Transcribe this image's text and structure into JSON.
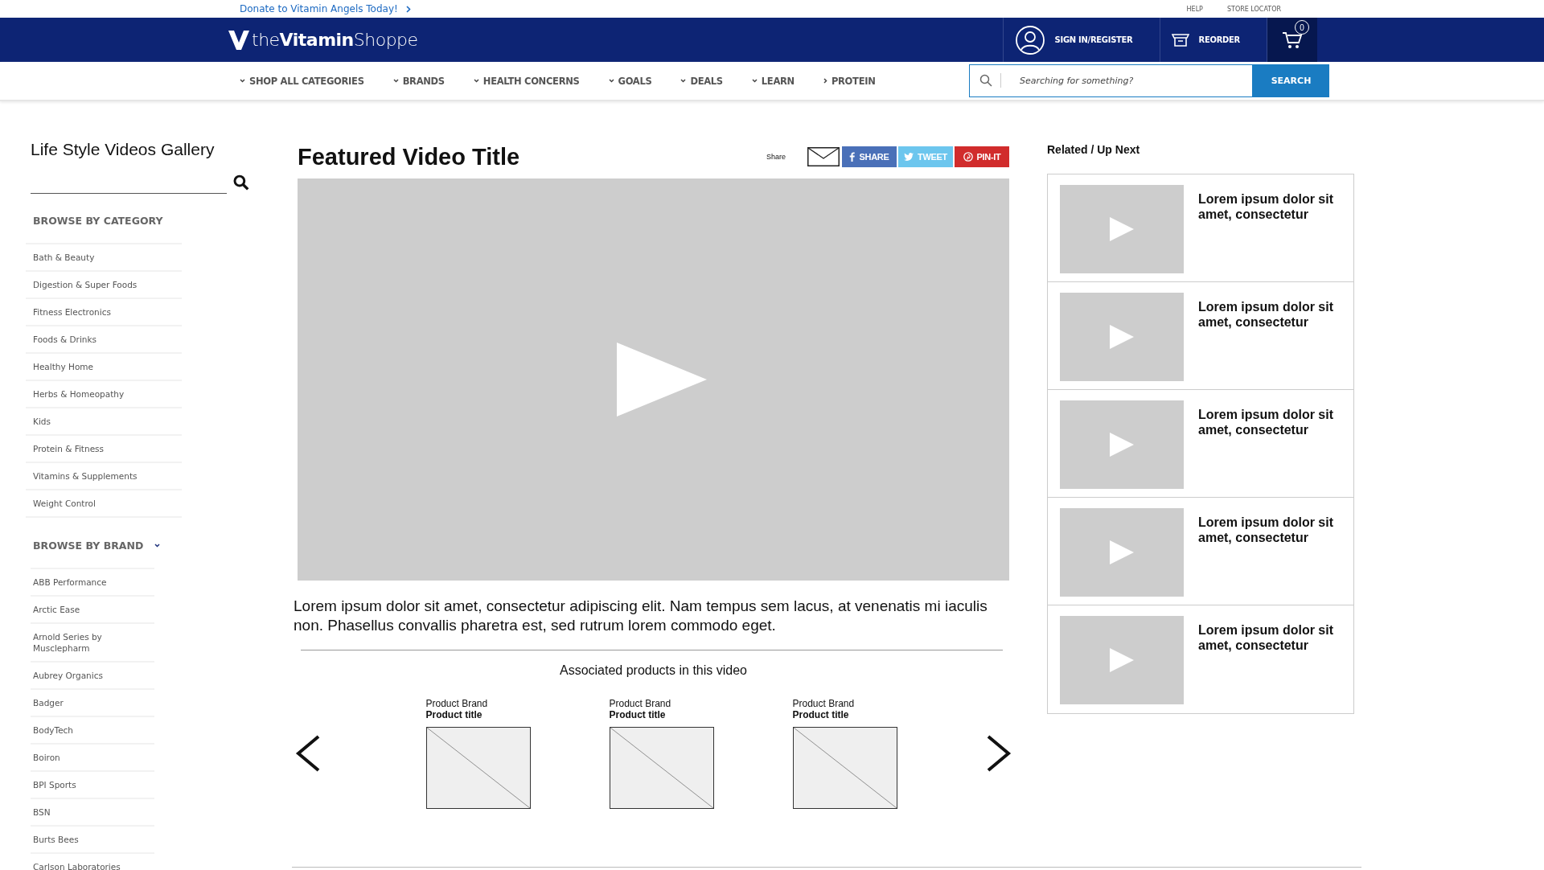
{
  "promo_bar": {
    "link": "Donate to Vitamin Angels Today!",
    "links": [
      "HELP",
      "STORE LOCATOR"
    ]
  },
  "header": {
    "logo": "the**Vitamin**Shoppe",
    "account": "SIGN IN/REGISTER",
    "reorder": "REORDER",
    "cart_count": "0"
  },
  "nav": {
    "items": [
      {
        "label": "SHOP ALL CATEGORIES",
        "kind": "dropdown"
      },
      {
        "label": "BRANDS",
        "kind": "dropdown"
      },
      {
        "label": "HEALTH CONCERNS",
        "kind": "dropdown"
      },
      {
        "label": "GOALS",
        "kind": "dropdown"
      },
      {
        "label": "DEALS",
        "kind": "dropdown"
      },
      {
        "label": "LEARN",
        "kind": "dropdown"
      },
      {
        "label": "PROTEIN",
        "kind": "link"
      }
    ],
    "search": {
      "placeholder": "Searching for something?",
      "button": "SEARCH"
    }
  },
  "sidebar": {
    "title": "Life Style Videos Gallery",
    "category_heading": "BROWSE BY CATEGORY",
    "categories": [
      "Bath & Beauty",
      "Digestion & Super Foods",
      "Fitness Electronics",
      "Foods & Drinks",
      "Healthy Home",
      "Herbs & Homeopathy",
      "Kids",
      "Protein & Fitness",
      "Vitamins & Supplements",
      "Weight Control"
    ],
    "brand_heading": "BROWSE BY BRAND",
    "brands": [
      "ABB Performance",
      "Arctic Ease",
      "Arnold Series by Musclepharm",
      "Aubrey Organics",
      "Badger",
      "BodyTech",
      "Boiron",
      "BPI Sports",
      "BSN",
      "Burts Bees",
      "Carlson Laboratories"
    ]
  },
  "video": {
    "title": "Featured Video Title",
    "share_label": "Share",
    "share_buttons": [
      {
        "label": "SHARE",
        "kind": "facebook"
      },
      {
        "label": "TWEET",
        "kind": "twitter"
      },
      {
        "label": "PIN-IT",
        "kind": "pinterest"
      }
    ],
    "description": "Lorem ipsum dolor sit amet, consectetur adipiscing elit. Nam tempus sem lacus, at venenatis mi iaculis non. Phasellus convallis pharetra est, sed rutrum lorem commodo eget."
  },
  "products": {
    "heading": "Associated products in this video",
    "items": [
      {
        "brand": "Product Brand",
        "title": "Product title"
      },
      {
        "brand": "Product Brand",
        "title": "Product title"
      },
      {
        "brand": "Product Brand",
        "title": "Product title"
      }
    ]
  },
  "related": {
    "heading": "Related / Up Next",
    "items": [
      {
        "title": "Lorem ipsum dolor sit amet, consectetur"
      },
      {
        "title": "Lorem ipsum dolor sit amet, consectetur"
      },
      {
        "title": "Lorem ipsum dolor sit amet, consectetur"
      },
      {
        "title": "Lorem ipsum dolor sit amet, consectetur"
      },
      {
        "title": "Lorem ipsum dolor sit amet, consectetur"
      }
    ]
  }
}
